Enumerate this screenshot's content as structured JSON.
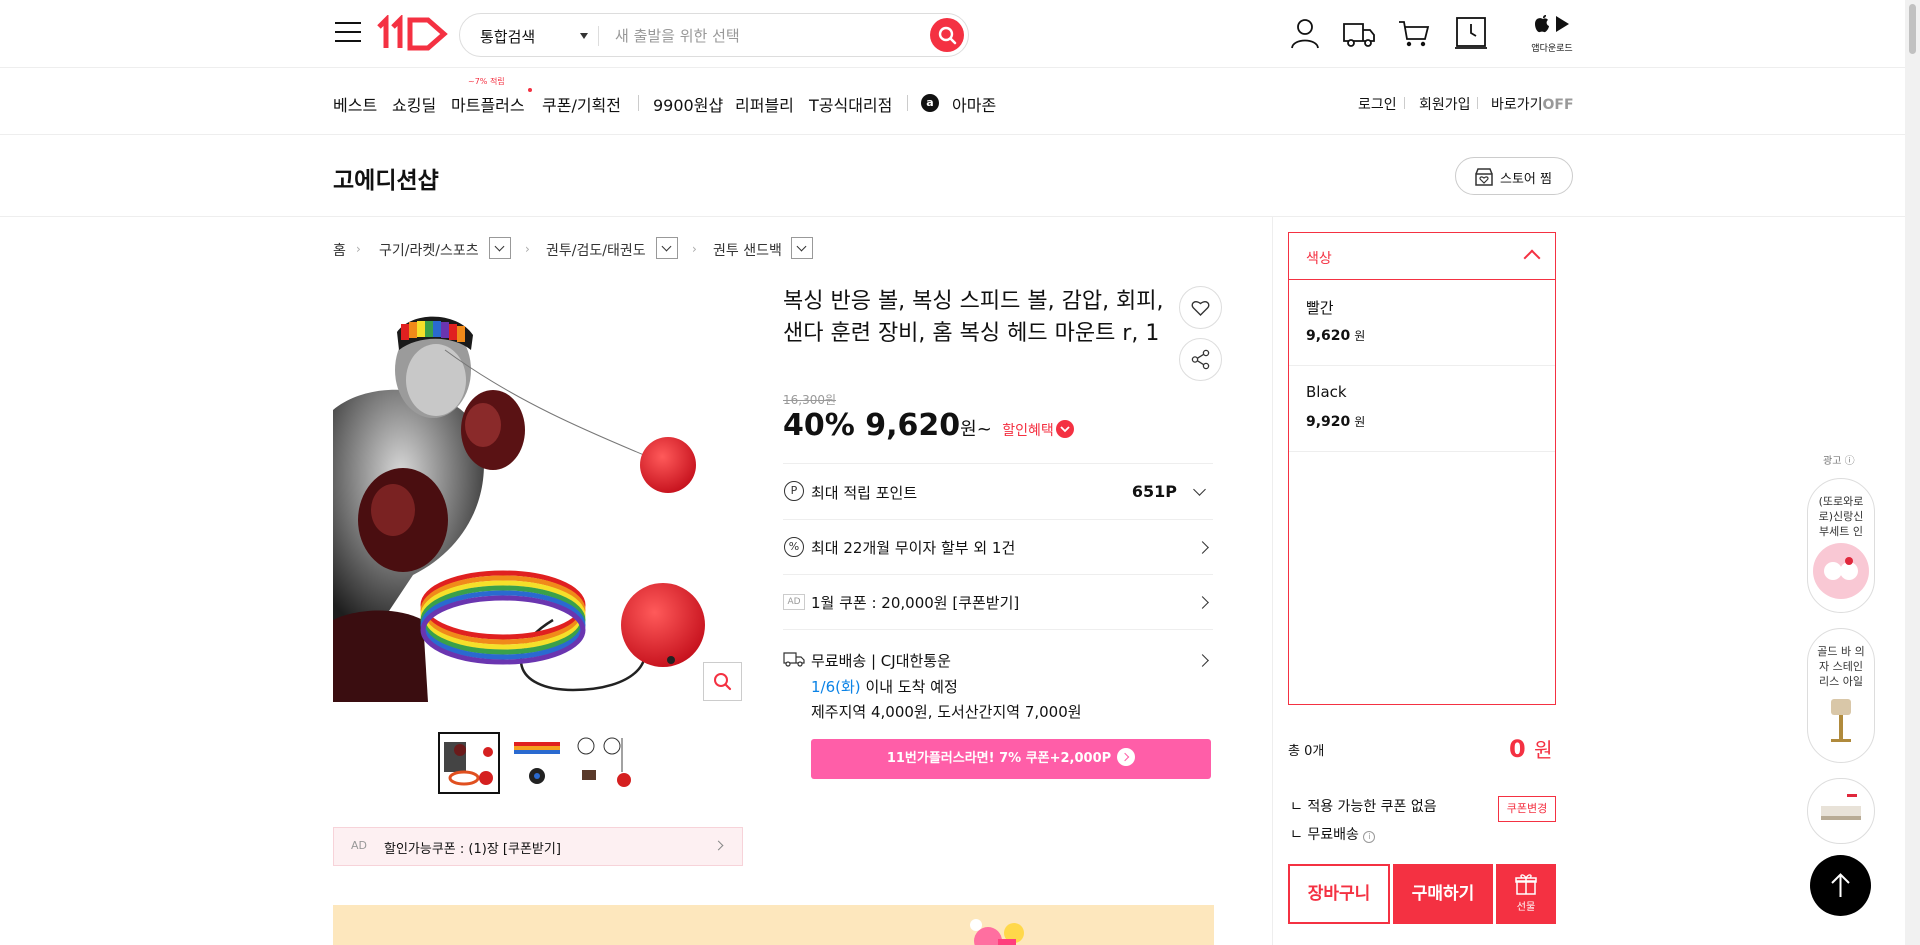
{
  "header": {
    "search_category": "통합검색",
    "search_placeholder": "새 출발을 위한 선택",
    "app_download_label": "앱다운로드"
  },
  "gnb": {
    "items": [
      "베스트",
      "쇼킹딜",
      "마트플러스",
      "쿠폰/기획전",
      "9900원샵",
      "리퍼블리",
      "T공식대리점",
      "아마존"
    ],
    "badge": "~7% 적립",
    "right": [
      "로그인",
      "회원가입",
      "바로가기",
      "OFF"
    ]
  },
  "store": {
    "name": "고에디션샵",
    "zzim_label": "스토어 찜"
  },
  "breadcrumb": [
    "홈",
    "구기/라켓/스포츠",
    "권투/검도/태권도",
    "권투 샌드백"
  ],
  "product": {
    "title": "복싱 반응 볼, 복싱 스피드 볼, 감압, 회피, 샌다 훈련 장비, 홈 복싱 헤드 마운트 r, 1",
    "original_price": "16,300원",
    "discount": "40%",
    "price": "9,620",
    "won": "원~",
    "benefit_label": "할인혜택",
    "rows": {
      "points_label": "최대 적립 포인트",
      "points_value": "651P",
      "installment": "최대 22개월 무이자 할부 외 1건",
      "coupon_ad": "AD",
      "coupon": "1월 쿠폰 : 20,000원 [쿠폰받기]",
      "shipping": "무료배송",
      "carrier": "CJ대한통운",
      "arrival_date": "1/6(화)",
      "arrival_text": "이내 도착 예정",
      "extra_fee": "제주지역 4,000원, 도서산간지역 7,000원"
    },
    "plus_banner": "11번가플러스라면! 7% 쿠폰+2,000P",
    "coupon_bar_ad": "AD",
    "coupon_bar": "할인가능쿠폰 : (1)장 [쿠폰받기]"
  },
  "options": {
    "header": "색상",
    "items": [
      {
        "name": "빨간",
        "price": "9,620",
        "unit": "원"
      },
      {
        "name": "Black",
        "price": "9,920",
        "unit": "원"
      }
    ]
  },
  "order": {
    "total_label": "총 0개",
    "total_price": "0",
    "total_unit": "원",
    "no_coupon": "적용 가능한 쿠폰 없음",
    "coupon_change": "쿠폰변경",
    "free_shipping": "무료배송",
    "cart": "장바구니",
    "buy": "구매하기",
    "gift": "선물"
  },
  "side_ads": {
    "label": "광고",
    "ad1": "(또로와로로)신랑신부세트 인",
    "ad2": "골드 바 의자 스테인리스 아일"
  },
  "colors": {
    "accent": "#f43142",
    "plus_banner": "#ff5ea8",
    "arrival_date": "#0b83e6"
  }
}
